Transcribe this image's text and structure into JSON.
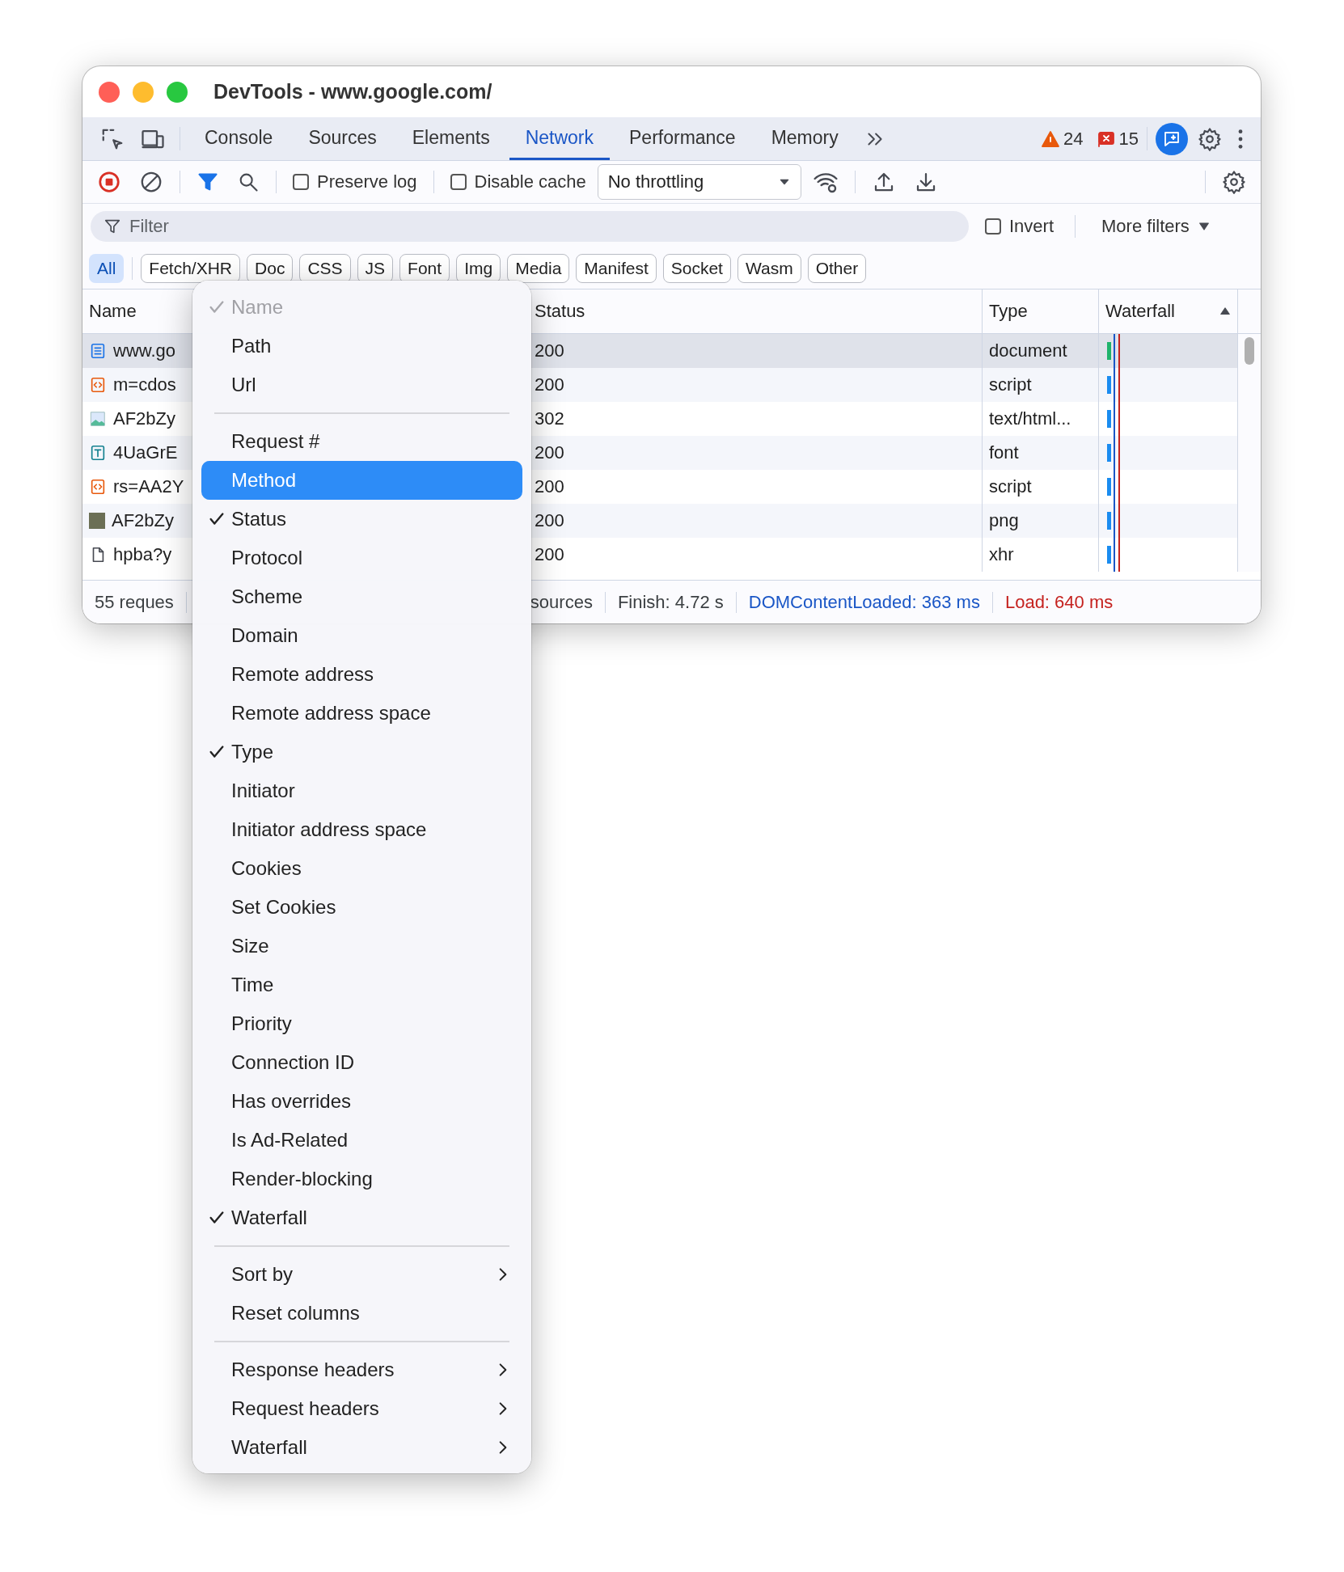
{
  "window": {
    "title": "DevTools - www.google.com/"
  },
  "tabs": [
    {
      "label": "Console",
      "selected": false
    },
    {
      "label": "Sources",
      "selected": false
    },
    {
      "label": "Elements",
      "selected": false
    },
    {
      "label": "Network",
      "selected": true
    },
    {
      "label": "Performance",
      "selected": false
    },
    {
      "label": "Memory",
      "selected": false
    }
  ],
  "issue_counts": {
    "warnings": "24",
    "errors": "15"
  },
  "toolbar": {
    "recording": true,
    "preserve_log": {
      "label": "Preserve log",
      "checked": false
    },
    "disable_cache": {
      "label": "Disable cache",
      "checked": false
    },
    "throttling": "No throttling"
  },
  "filter": {
    "placeholder": "Filter",
    "invert": {
      "label": "Invert",
      "checked": false
    },
    "more_filters": "More filters"
  },
  "type_chips": [
    {
      "label": "All",
      "selected": true
    },
    {
      "label": "Fetch/XHR",
      "selected": false
    },
    {
      "label": "Doc",
      "selected": false
    },
    {
      "label": "CSS",
      "selected": false
    },
    {
      "label": "JS",
      "selected": false
    },
    {
      "label": "Font",
      "selected": false
    },
    {
      "label": "Img",
      "selected": false
    },
    {
      "label": "Media",
      "selected": false
    },
    {
      "label": "Manifest",
      "selected": false
    },
    {
      "label": "Socket",
      "selected": false
    },
    {
      "label": "Wasm",
      "selected": false
    },
    {
      "label": "Other",
      "selected": false
    }
  ],
  "table": {
    "columns": [
      "Name",
      "Status",
      "Type",
      "Waterfall"
    ],
    "rows": [
      {
        "kind": "document",
        "name": "www.go",
        "status": "200",
        "type": "document",
        "selected": true
      },
      {
        "kind": "script",
        "name": "m=cdos",
        "status": "200",
        "type": "script",
        "selected": false
      },
      {
        "kind": "image",
        "name": "AF2bZy",
        "status": "302",
        "type": "text/html...",
        "selected": false
      },
      {
        "kind": "font",
        "name": "4UaGrE",
        "status": "200",
        "type": "font",
        "selected": false
      },
      {
        "kind": "script",
        "name": "rs=AA2Y",
        "status": "200",
        "type": "script",
        "selected": false
      },
      {
        "kind": "photo",
        "name": "AF2bZy",
        "status": "200",
        "type": "png",
        "selected": false
      },
      {
        "kind": "file",
        "name": "hpba?y",
        "status": "200",
        "type": "xhr",
        "selected": false
      }
    ]
  },
  "status_bar": [
    {
      "kind": "plain",
      "text": "55 reques"
    },
    {
      "kind": "plain",
      "text": "sources"
    },
    {
      "kind": "plain",
      "text": "Finish: 4.72 s"
    },
    {
      "kind": "dcl",
      "text": "DOMContentLoaded: 363 ms"
    },
    {
      "kind": "load",
      "text": "Load: 640 ms"
    }
  ],
  "context_menu": [
    {
      "kind": "item",
      "label": "Name",
      "checked": true,
      "disabled": true,
      "selected": false
    },
    {
      "kind": "item",
      "label": "Path",
      "checked": false,
      "disabled": false,
      "selected": false
    },
    {
      "kind": "item",
      "label": "Url",
      "checked": false,
      "disabled": false,
      "selected": false
    },
    {
      "kind": "separator"
    },
    {
      "kind": "item",
      "label": "Request #",
      "checked": false,
      "disabled": false,
      "selected": false
    },
    {
      "kind": "item",
      "label": "Method",
      "checked": false,
      "disabled": false,
      "selected": true
    },
    {
      "kind": "item",
      "label": "Status",
      "checked": true,
      "disabled": false,
      "selected": false
    },
    {
      "kind": "item",
      "label": "Protocol",
      "checked": false,
      "disabled": false,
      "selected": false
    },
    {
      "kind": "item",
      "label": "Scheme",
      "checked": false,
      "disabled": false,
      "selected": false
    },
    {
      "kind": "item",
      "label": "Domain",
      "checked": false,
      "disabled": false,
      "selected": false
    },
    {
      "kind": "item",
      "label": "Remote address",
      "checked": false,
      "disabled": false,
      "selected": false
    },
    {
      "kind": "item",
      "label": "Remote address space",
      "checked": false,
      "disabled": false,
      "selected": false
    },
    {
      "kind": "item",
      "label": "Type",
      "checked": true,
      "disabled": false,
      "selected": false
    },
    {
      "kind": "item",
      "label": "Initiator",
      "checked": false,
      "disabled": false,
      "selected": false
    },
    {
      "kind": "item",
      "label": "Initiator address space",
      "checked": false,
      "disabled": false,
      "selected": false
    },
    {
      "kind": "item",
      "label": "Cookies",
      "checked": false,
      "disabled": false,
      "selected": false
    },
    {
      "kind": "item",
      "label": "Set Cookies",
      "checked": false,
      "disabled": false,
      "selected": false
    },
    {
      "kind": "item",
      "label": "Size",
      "checked": false,
      "disabled": false,
      "selected": false
    },
    {
      "kind": "item",
      "label": "Time",
      "checked": false,
      "disabled": false,
      "selected": false
    },
    {
      "kind": "item",
      "label": "Priority",
      "checked": false,
      "disabled": false,
      "selected": false
    },
    {
      "kind": "item",
      "label": "Connection ID",
      "checked": false,
      "disabled": false,
      "selected": false
    },
    {
      "kind": "item",
      "label": "Has overrides",
      "checked": false,
      "disabled": false,
      "selected": false
    },
    {
      "kind": "item",
      "label": "Is Ad-Related",
      "checked": false,
      "disabled": false,
      "selected": false
    },
    {
      "kind": "item",
      "label": "Render-blocking",
      "checked": false,
      "disabled": false,
      "selected": false
    },
    {
      "kind": "item",
      "label": "Waterfall",
      "checked": true,
      "disabled": false,
      "selected": false
    },
    {
      "kind": "separator"
    },
    {
      "kind": "submenu",
      "label": "Sort by",
      "selected": false
    },
    {
      "kind": "item",
      "label": "Reset columns",
      "checked": false,
      "disabled": false,
      "selected": false
    },
    {
      "kind": "separator"
    },
    {
      "kind": "submenu",
      "label": "Response headers",
      "selected": false
    },
    {
      "kind": "submenu",
      "label": "Request headers",
      "selected": false
    },
    {
      "kind": "submenu",
      "label": "Waterfall",
      "selected": false
    }
  ]
}
